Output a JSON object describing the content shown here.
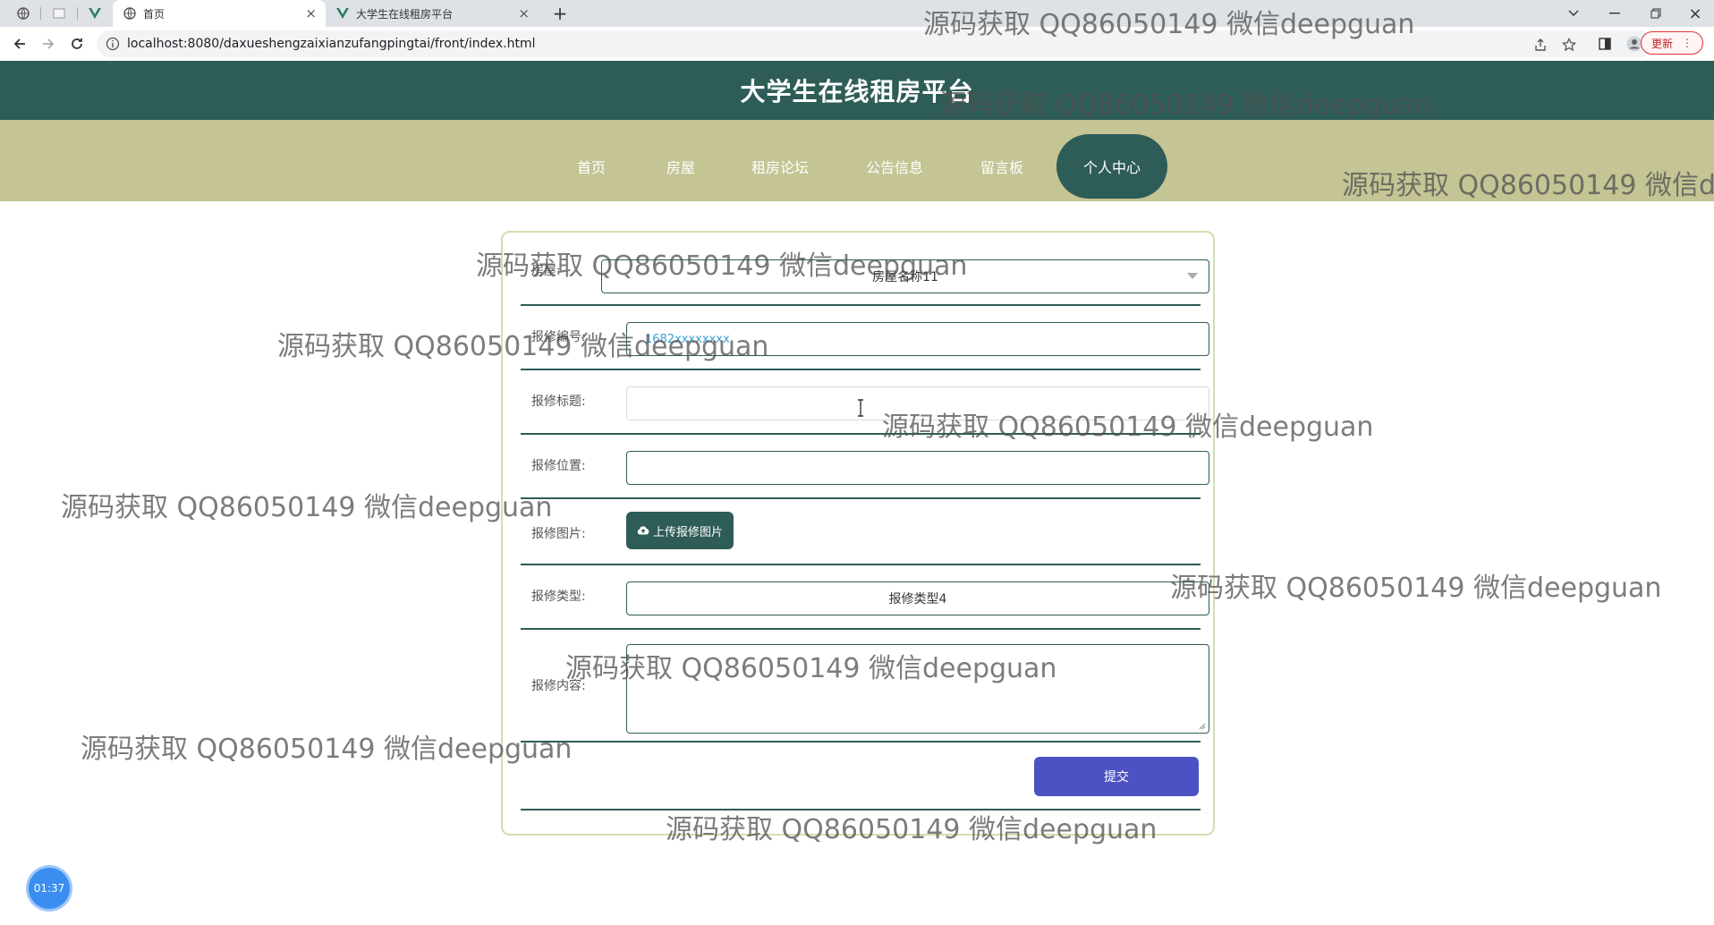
{
  "browser": {
    "tabs": [
      {
        "title": "首页",
        "active": true
      },
      {
        "title": "大学生在线租房平台",
        "active": false
      }
    ],
    "url": "localhost:8080/daxueshengzaixianzufangpingtai/front/index.html",
    "update_label": "更新"
  },
  "site": {
    "title": "大学生在线租房平台",
    "nav": [
      {
        "label": "首页"
      },
      {
        "label": "房屋"
      },
      {
        "label": "租房论坛"
      },
      {
        "label": "公告信息"
      },
      {
        "label": "留言板"
      },
      {
        "label": "个人中心",
        "active": true
      }
    ]
  },
  "form": {
    "house": {
      "label": "房屋:",
      "value": "房屋名称11"
    },
    "repair_no": {
      "label": "报修编号:",
      "placeholder": "1682xxxxxxxx"
    },
    "repair_title": {
      "label": "报修标题:",
      "value": ""
    },
    "repair_location": {
      "label": "报修位置:",
      "value": ""
    },
    "repair_image": {
      "label": "报修图片:",
      "button": "上传报修图片"
    },
    "repair_type": {
      "label": "报修类型:",
      "value": "报修类型4"
    },
    "repair_content": {
      "label": "报修内容:",
      "value": ""
    },
    "submit": "提交"
  },
  "timer": "01:37",
  "watermark_text": "源码获取 QQ86050149 微信deepguan",
  "colors": {
    "header_bg": "#2e5c57",
    "nav_bg": "#c4c495",
    "submit_bg": "#4c52c3"
  }
}
